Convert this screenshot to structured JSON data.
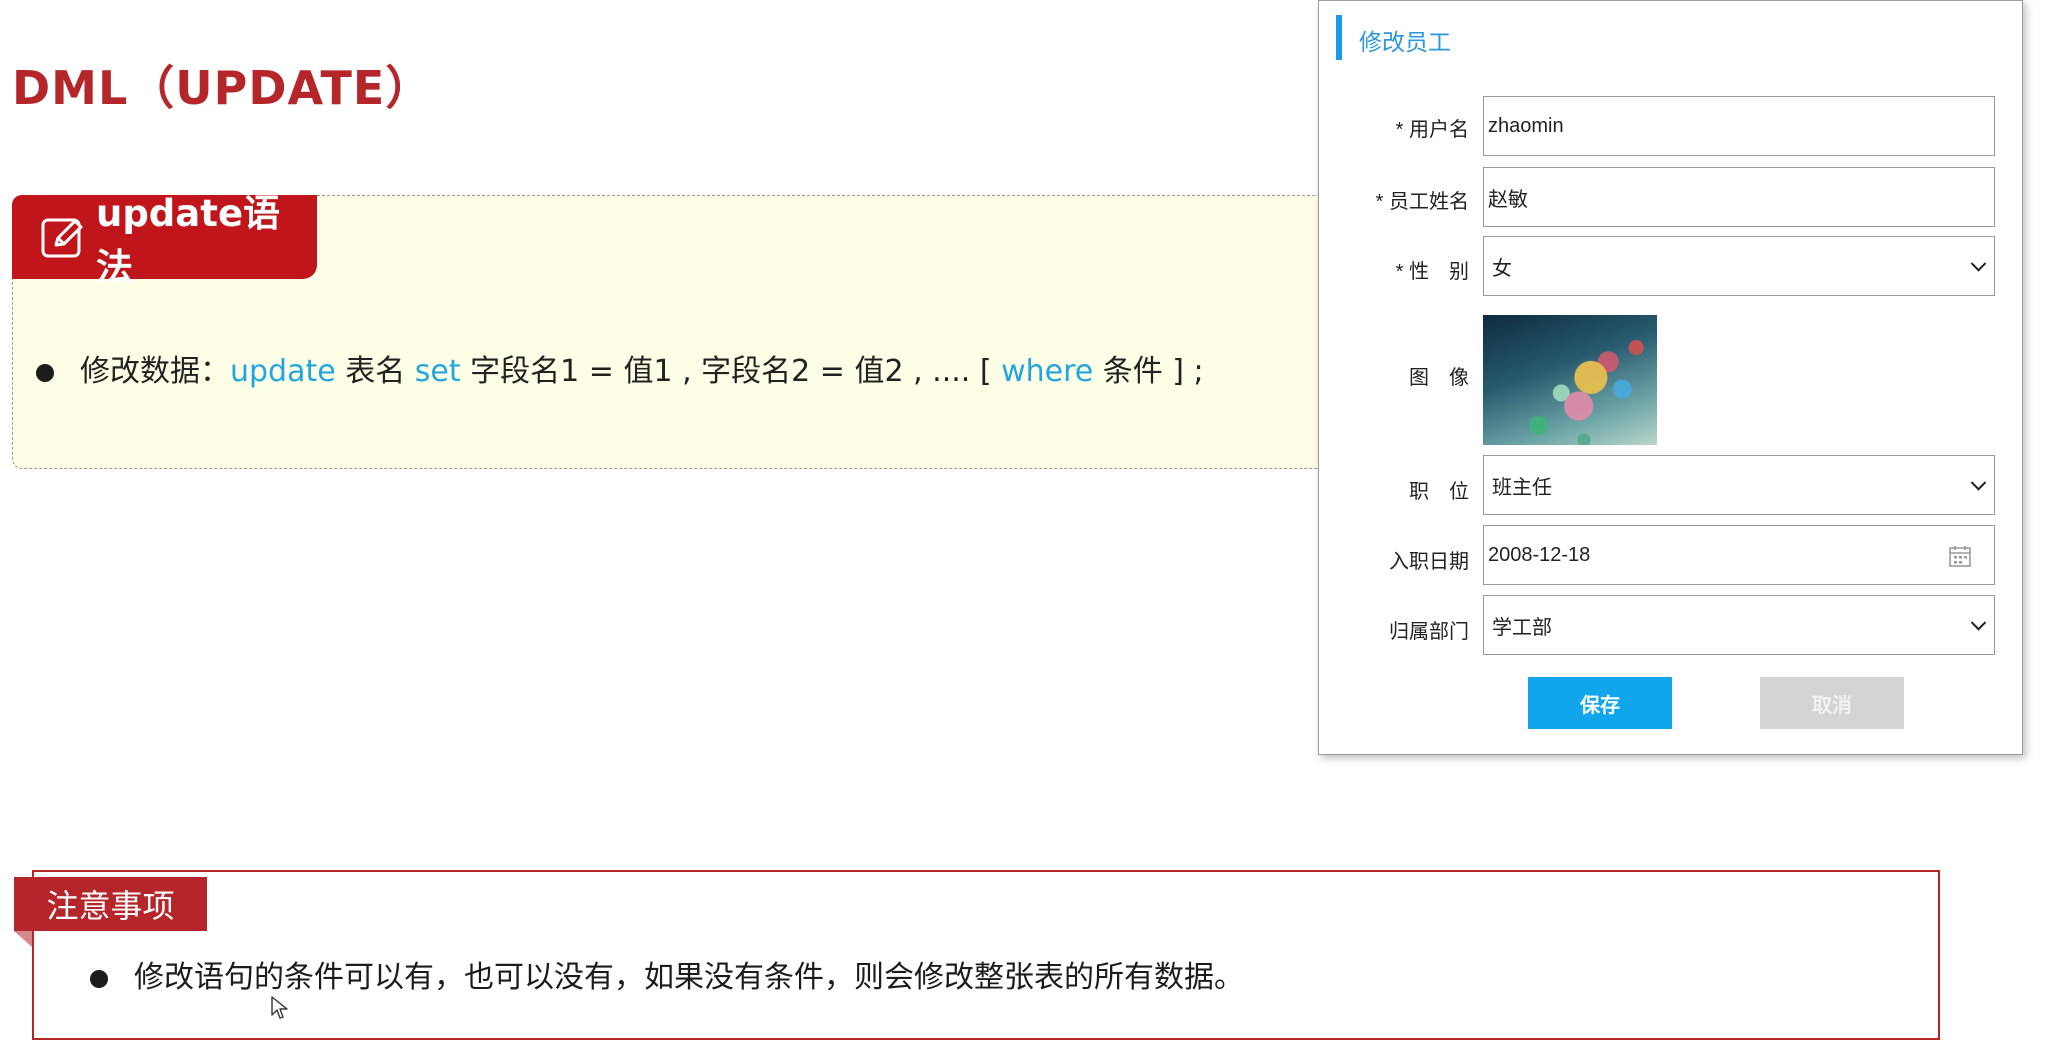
{
  "slide": {
    "title": "DML（UPDATE）",
    "syntax_tag": "update语法",
    "syntax_line": {
      "prefix": "修改数据：",
      "kw_update": "update",
      "table": " 表名 ",
      "kw_set": "set",
      "body": " 字段名1 = 值1 , 字段名2 = 值2 , .... [ ",
      "kw_where": "where",
      "tail": " 条件 ] ;"
    },
    "note_tag": "注意事项",
    "note_text": "修改语句的条件可以有，也可以没有，如果没有条件，则会修改整张表的所有数据。"
  },
  "dialog": {
    "title": "修改员工",
    "fields": {
      "username_label": "* 用户名",
      "username_value": "zhaomin",
      "name_label": "* 员工姓名",
      "name_value": "赵敏",
      "gender_label": "* 性　别",
      "gender_value": "女",
      "image_label": "图　像",
      "position_label": "职　位",
      "position_value": "班主任",
      "hire_date_label": "入职日期",
      "hire_date_value": "2008-12-18",
      "dept_label": "归属部门",
      "dept_value": "学工部"
    },
    "save_label": "保存",
    "cancel_label": "取消"
  },
  "colors": {
    "title_red": "#b5262b",
    "tag_red": "#c0151b",
    "keyword_blue": "#22a6e0",
    "primary_button": "#11a6ec",
    "disabled_button": "#d4d4d4"
  },
  "icons": [
    "edit-icon",
    "calendar-icon",
    "chevron-down-icon",
    "mouse-cursor-icon"
  ]
}
